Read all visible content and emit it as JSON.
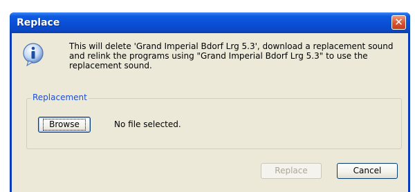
{
  "window": {
    "title": "Replace",
    "close_glyph": "✕"
  },
  "message": {
    "icon": "information-icon",
    "text": "This will delete 'Grand Imperial Bdorf Lrg 5.3', download a replacement sound and relink the programs using \"Grand Imperial Bdorf Lrg 5.3\" to use the replacement sound."
  },
  "replacement_group": {
    "legend": "Replacement",
    "browse_label": "Browse",
    "file_status": "No file selected."
  },
  "buttons": {
    "replace_label": "Replace",
    "cancel_label": "Cancel"
  },
  "colors": {
    "titlebar": "#0a4fd6",
    "client_background": "#ece9d8",
    "legend_text": "#1f4fd0",
    "close_button": "#d9532e"
  }
}
